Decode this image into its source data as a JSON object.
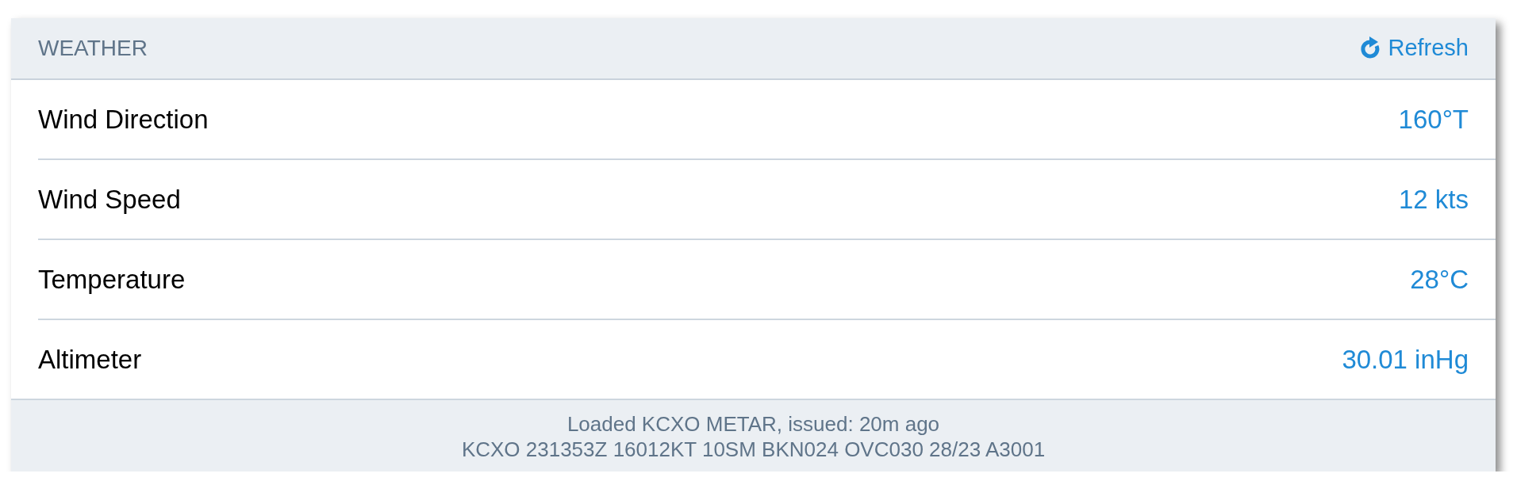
{
  "panel": {
    "title": "WEATHER",
    "refresh_button": "Refresh"
  },
  "rows": [
    {
      "label": "Wind Direction",
      "value": "160°T"
    },
    {
      "label": "Wind Speed",
      "value": "12 kts"
    },
    {
      "label": "Temperature",
      "value": "28°C"
    },
    {
      "label": "Altimeter",
      "value": "30.01 inHg"
    }
  ],
  "footer": {
    "status": "Loaded KCXO METAR, issued: 20m ago",
    "metar": "KCXO 231353Z 16012KT 10SM BKN024 OVC030 28/23 A3001"
  }
}
